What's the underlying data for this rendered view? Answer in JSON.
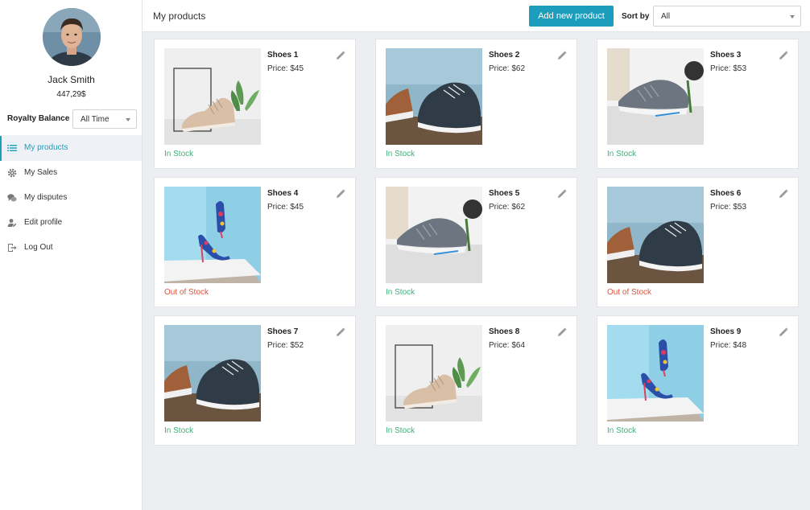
{
  "user": {
    "name": "Jack Smith",
    "balance": "447,29$"
  },
  "royalty": {
    "label": "Royalty Balance",
    "period": "All Time"
  },
  "nav": [
    {
      "label": "My products",
      "icon": "list-icon",
      "active": true
    },
    {
      "label": "My Sales",
      "icon": "gear-icon",
      "active": false
    },
    {
      "label": "My disputes",
      "icon": "chat-icon",
      "active": false
    },
    {
      "label": "Edit profile",
      "icon": "user-edit-icon",
      "active": false
    },
    {
      "label": "Log Out",
      "icon": "logout-icon",
      "active": false
    }
  ],
  "header": {
    "title": "My products",
    "add_label": "Add new product",
    "sort_label": "Sort by",
    "sort_value": "All"
  },
  "colors": {
    "accent": "#1b9dbb",
    "in_stock": "#3db07a",
    "out_of_stock": "#e0533e"
  },
  "products": [
    {
      "name": "Shoes 1",
      "price": "Price: $45",
      "status": "In Stock",
      "in_stock": true,
      "image": "beige-sneaker-photo"
    },
    {
      "name": "Shoes 2",
      "price": "Price: $62",
      "status": "In Stock",
      "in_stock": true,
      "image": "dark-canvas-shoe-photo"
    },
    {
      "name": "Shoes 3",
      "price": "Price: $53",
      "status": "In Stock",
      "in_stock": true,
      "image": "grey-running-shoe-photo"
    },
    {
      "name": "Shoes 4",
      "price": "Price: $45",
      "status": "Out of Stock",
      "in_stock": false,
      "image": "floral-heels-photo"
    },
    {
      "name": "Shoes 5",
      "price": "Price: $62",
      "status": "In Stock",
      "in_stock": true,
      "image": "grey-running-shoe-photo"
    },
    {
      "name": "Shoes 6",
      "price": "Price: $53",
      "status": "Out of Stock",
      "in_stock": false,
      "image": "dark-canvas-shoe-photo"
    },
    {
      "name": "Shoes 7",
      "price": "Price: $52",
      "status": "In Stock",
      "in_stock": true,
      "image": "dark-canvas-shoe-photo"
    },
    {
      "name": "Shoes 8",
      "price": "Price: $64",
      "status": "In Stock",
      "in_stock": true,
      "image": "beige-sneaker-photo"
    },
    {
      "name": "Shoes 9",
      "price": "Price: $48",
      "status": "In Stock",
      "in_stock": true,
      "image": "floral-heels-photo"
    }
  ]
}
